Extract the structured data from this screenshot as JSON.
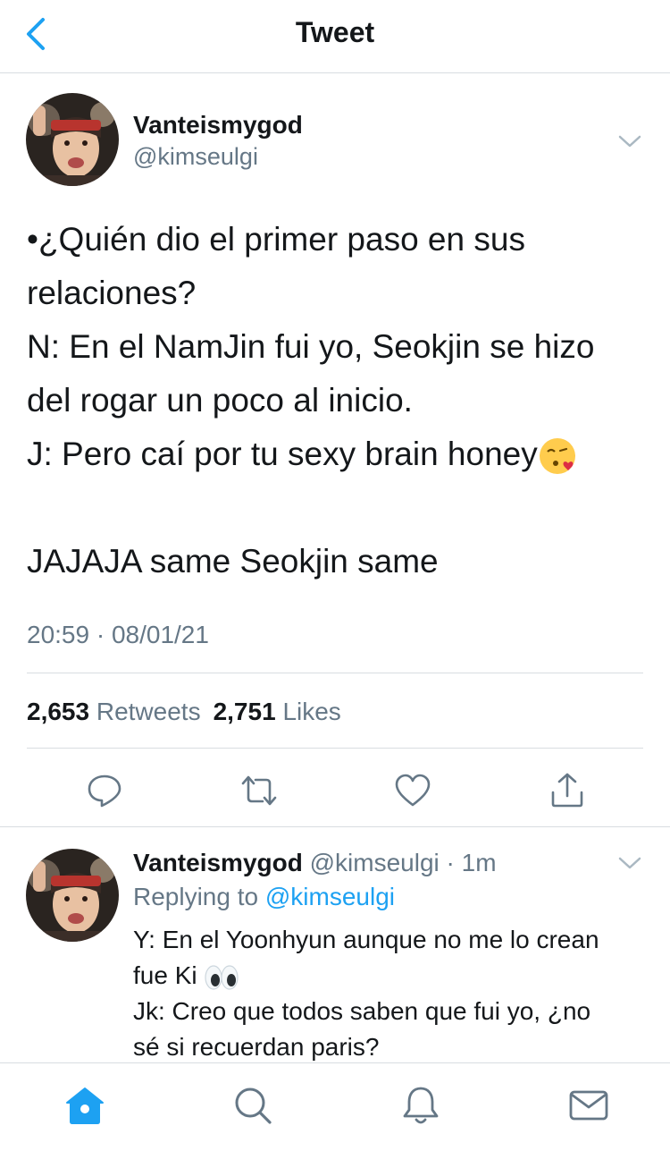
{
  "header": {
    "title": "Tweet",
    "back_icon": "chevron-left-icon"
  },
  "tweet": {
    "display_name": "Vanteismygod",
    "handle": "@kimseulgi",
    "body_lines": [
      "•¿Quién dio el primer paso en sus relaciones?",
      "N: En el NamJin fui yo, Seokjin se hizo del rogar un poco al inicio.",
      "J: Pero caí por tu sexy brain honey",
      "",
      "JAJAJA same Seokjin same"
    ],
    "emoji_line3": "kissing-face-with-heart-emoji",
    "timestamp": "20:59 · 08/01/21",
    "retweets_count": "2,653",
    "retweets_label": "Retweets",
    "likes_count": "2,751",
    "likes_label": "Likes",
    "actions": [
      "reply-icon",
      "retweet-icon",
      "like-icon",
      "share-icon"
    ]
  },
  "reply": {
    "display_name": "Vanteismygod",
    "meta": "@kimseulgi · 1m",
    "replying_prefix": "Replying to",
    "replying_handle": "@kimseulgi",
    "body_line1": "Y: En el Yoonhyun aunque no me lo crean",
    "body_line2_text": "fue Ki",
    "body_line2_emoji": "eyes-emoji",
    "body_line3": "Jk: Creo que todos saben que fui yo, ¿no",
    "body_line4": "sé si recuerdan paris?"
  },
  "tabbar": {
    "items": [
      "home-icon",
      "search-icon",
      "notifications-icon",
      "messages-icon"
    ],
    "active_color": "#1da1f2",
    "inactive_color": "#657786"
  },
  "colors": {
    "accent": "#1da1f2",
    "secondary_text": "#657786",
    "divider": "#d8dde1"
  }
}
